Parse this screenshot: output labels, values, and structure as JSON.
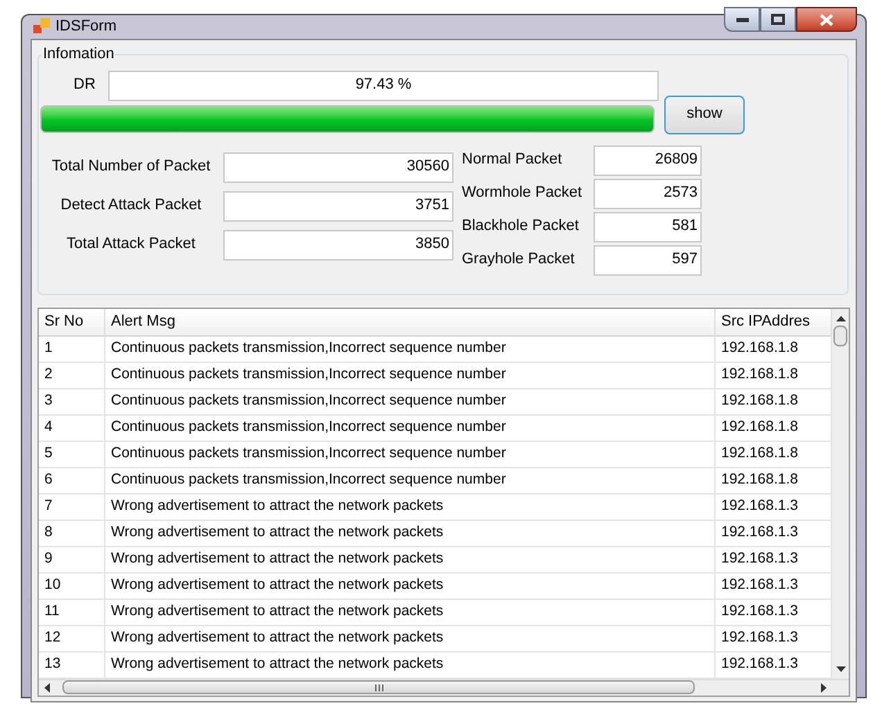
{
  "window": {
    "title": "IDSForm"
  },
  "group": {
    "title": "Infomation"
  },
  "dr": {
    "label": "DR",
    "value": "97.43 %"
  },
  "progress": {
    "level": 1
  },
  "show_button": "show",
  "left_fields": [
    {
      "label": "Total Number of Packet",
      "value": "30560"
    },
    {
      "label": "Detect Attack Packet",
      "value": "3751"
    },
    {
      "label": "Total Attack Packet",
      "value": "3850"
    }
  ],
  "right_fields": [
    {
      "label": "Normal Packet",
      "value": "26809"
    },
    {
      "label": "Wormhole Packet",
      "value": "2573"
    },
    {
      "label": "Blackhole Packet",
      "value": "581"
    },
    {
      "label": "Grayhole Packet",
      "value": "597"
    }
  ],
  "table": {
    "columns": [
      "Sr No",
      "Alert Msg",
      "Src IPAddres"
    ],
    "rows": [
      [
        "1",
        "Continuous packets transmission,Incorrect sequence number",
        "192.168.1.8"
      ],
      [
        "2",
        "Continuous packets transmission,Incorrect sequence number",
        "192.168.1.8"
      ],
      [
        "3",
        "Continuous packets transmission,Incorrect sequence number",
        "192.168.1.8"
      ],
      [
        "4",
        "Continuous packets transmission,Incorrect sequence number",
        "192.168.1.8"
      ],
      [
        "5",
        "Continuous packets transmission,Incorrect sequence number",
        "192.168.1.8"
      ],
      [
        "6",
        "Continuous packets transmission,Incorrect sequence number",
        "192.168.1.8"
      ],
      [
        "7",
        "Wrong advertisement to attract the network packets",
        "192.168.1.3"
      ],
      [
        "8",
        "Wrong advertisement to attract the network packets",
        "192.168.1.3"
      ],
      [
        "9",
        "Wrong advertisement to attract the network packets",
        "192.168.1.3"
      ],
      [
        "10",
        "Wrong advertisement to attract the network packets",
        "192.168.1.3"
      ],
      [
        "11",
        "Wrong advertisement to attract the network packets",
        "192.168.1.3"
      ],
      [
        "12",
        "Wrong advertisement to attract the network packets",
        "192.168.1.3"
      ],
      [
        "13",
        "Wrong advertisement to attract the network packets",
        "192.168.1.3"
      ]
    ]
  }
}
